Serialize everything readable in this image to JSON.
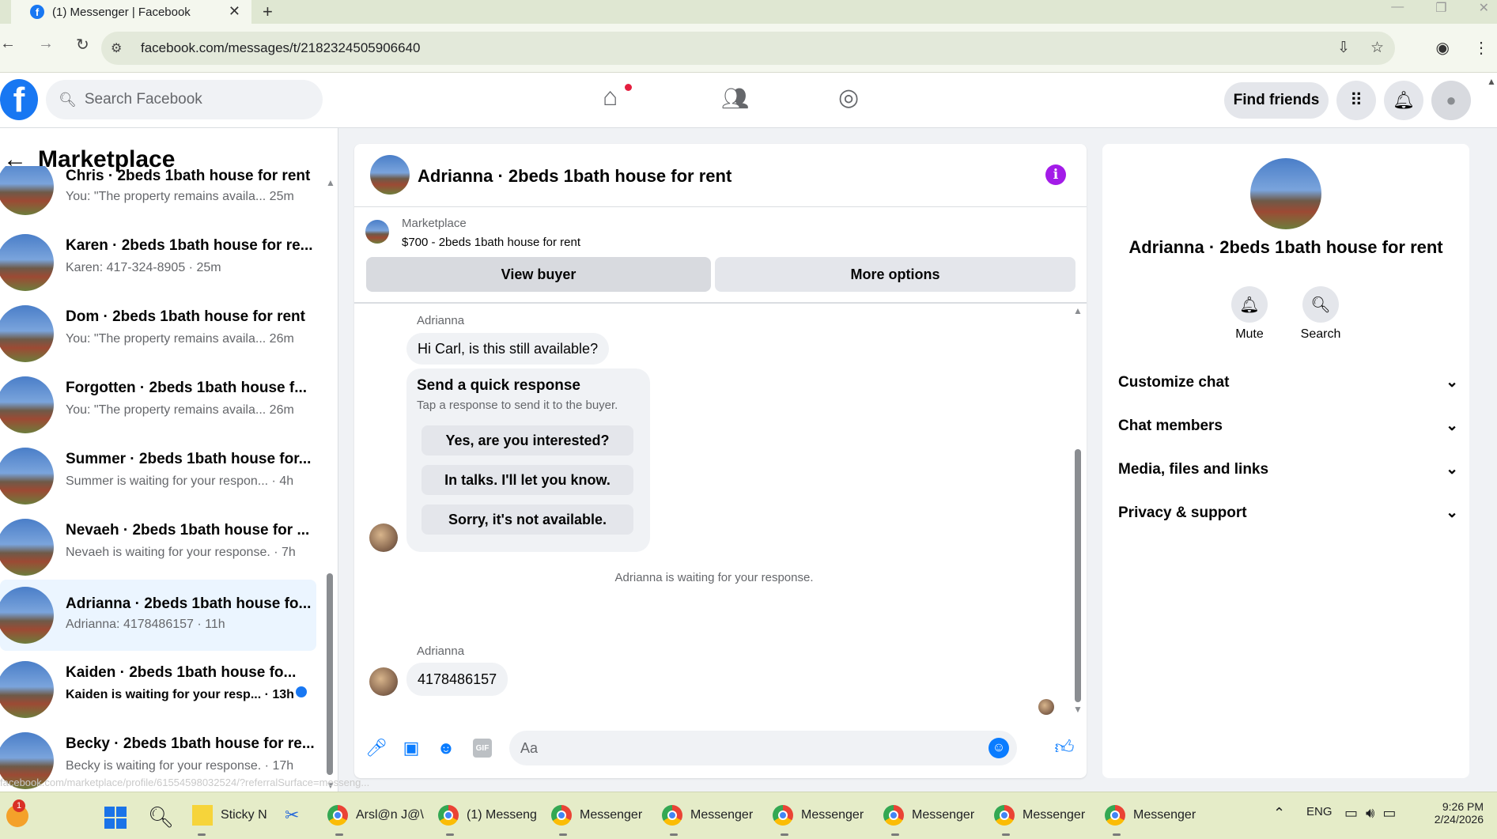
{
  "browser": {
    "tab_title": "(1) Messenger | Facebook",
    "url": "facebook.com/messages/t/2182324505906640"
  },
  "header": {
    "search_placeholder": "Search Facebook",
    "find_friends": "Find friends",
    "brand_color": "#1877f2"
  },
  "left": {
    "title": "Marketplace",
    "conversations": [
      {
        "title": "Chris · 2beds 1bath house for rent",
        "snippet": "You: \"The property remains availa... 25m",
        "unread": false
      },
      {
        "title": "Karen · 2beds 1bath house for re...",
        "snippet": "Karen: 417-324-8905 · 25m",
        "unread": false
      },
      {
        "title": "Dom · 2beds 1bath house for rent",
        "snippet": "You: \"The property remains availa... 26m",
        "unread": false
      },
      {
        "title": "Forgotten · 2beds 1bath house f...",
        "snippet": "You: \"The property remains availa... 26m",
        "unread": false
      },
      {
        "title": "Summer · 2beds 1bath house for...",
        "snippet": "Summer is waiting for your respon... · 4h",
        "unread": false
      },
      {
        "title": "Nevaeh · 2beds 1bath house for ...",
        "snippet": "Nevaeh is waiting for your response. · 7h",
        "unread": false
      },
      {
        "title": "Adrianna · 2beds 1bath house fo...",
        "snippet": "Adrianna: 4178486157 · 11h",
        "unread": false
      },
      {
        "title": "Kaiden · 2beds 1bath house fo...",
        "snippet": "Kaiden is waiting for your resp... · 13h",
        "unread": true
      },
      {
        "title": "Becky · 2beds 1bath house for re...",
        "snippet": "Becky is waiting for your response. · 17h",
        "unread": false
      }
    ]
  },
  "chat": {
    "title": "Adrianna · 2beds 1bath house for rent",
    "listing_label": "Marketplace",
    "listing_text": "$700 - 2beds 1bath house for rent",
    "view_buyer": "View buyer",
    "more_options": "More options",
    "sender": "Adrianna",
    "msg1": "Hi Carl, is this still available?",
    "quick_title": "Send a quick response",
    "quick_sub": "Tap a response to send it to the buyer.",
    "quick_replies": [
      "Yes, are you interested?",
      "In talks. I'll let you know.",
      "Sorry, it's not available."
    ],
    "waiting": "Adrianna is waiting for your response.",
    "sender2": "Adrianna",
    "msg2": "4178486157",
    "input_placeholder": "Aa",
    "gif_label": "GIF"
  },
  "info_panel": {
    "name": "Adrianna · 2beds 1bath house for rent",
    "mute": "Mute",
    "search": "Search",
    "rows": [
      "Customize chat",
      "Chat members",
      "Media, files and links",
      "Privacy & support"
    ]
  },
  "status_url": "facebook.com/marketplace/profile/61554598032524/?referralSurface=messeng...",
  "taskbar": {
    "items": [
      "Sticky N",
      "Arsl@n J@\\",
      "(1) Messeng",
      "Messenger",
      "Messenger",
      "Messenger",
      "Messenger",
      "Messenger",
      "Messenger"
    ],
    "lang": "ENG",
    "time": "9:26 PM",
    "date": "2/24/2026",
    "notif_count": "1"
  }
}
